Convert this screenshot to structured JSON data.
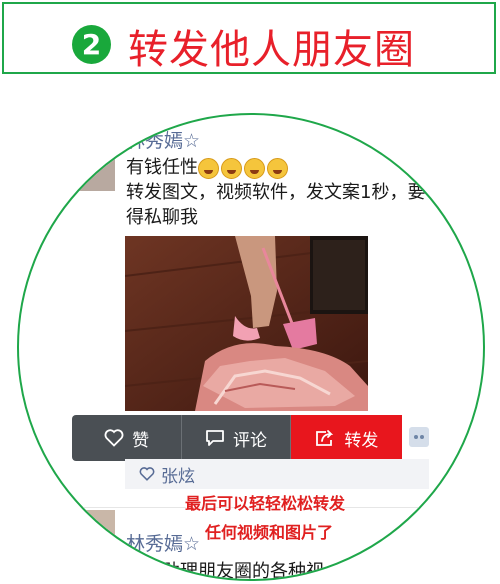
{
  "header": {
    "step_number": "2",
    "title": "转发他人朋友圈"
  },
  "post": {
    "author": "林秀嫣☆",
    "line1": "有钱任性",
    "emoji": "laughing-crying-emoji",
    "emoji_count": 4,
    "line2": "转发图文，视频软件，发文案1秒，要",
    "line3": "得私聊我"
  },
  "actions": {
    "like_label": "赞",
    "comment_label": "评论",
    "forward_label": "转发"
  },
  "likes": {
    "names": "张炫"
  },
  "overlay": {
    "line1": "最后可以轻轻松松转发",
    "line2": "任何视频和图片了"
  },
  "next_post": {
    "author": "林秀嫣☆",
    "text": "轻松助理朋友圈的各种视"
  },
  "colors": {
    "frame_green": "#1fa74a",
    "title_red": "#e8202a",
    "forward_red": "#e8161d",
    "link_blue": "#576b95",
    "action_bar": "#4a4f54"
  }
}
